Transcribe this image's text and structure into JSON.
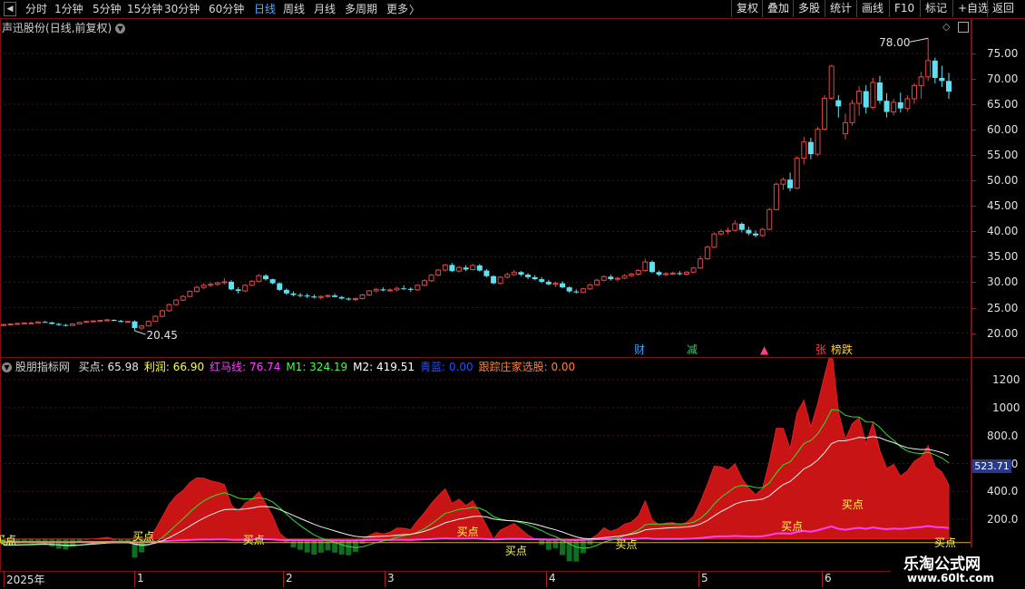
{
  "toolbar": {
    "periods": [
      "分时",
      "1分钟",
      "5分钟",
      "15分钟",
      "30分钟",
      "60分钟",
      "日线",
      "周线",
      "月线",
      "多周期",
      "更多"
    ],
    "active_period": "日线",
    "right_buttons": [
      "复权",
      "叠加",
      "多股",
      "统计",
      "画线",
      "F10",
      "标记",
      "+自选",
      "返回"
    ]
  },
  "main_chart": {
    "stock_name": "声迅股份",
    "mode": "(日线,前复权)",
    "high_label": "78.00",
    "low_label": "20.45",
    "price_axis": [
      "75.00",
      "70.00",
      "65.00",
      "60.00",
      "55.00",
      "50.00",
      "45.00",
      "40.00",
      "35.00",
      "30.00",
      "25.00",
      "20.00"
    ],
    "event_badges": [
      {
        "text": "财",
        "color": "#3ea0ff"
      },
      {
        "text": "减",
        "color": "#33cc66"
      },
      {
        "text": "▲",
        "color": "#ff4080"
      },
      {
        "text": "张",
        "color": "#ff4040"
      },
      {
        "text": "榜跌",
        "color": "#ffd040"
      }
    ]
  },
  "indicator": {
    "name": "股朋指标网",
    "values": [
      {
        "label": "买点:",
        "value": "65.98",
        "color": "#e6e6e6"
      },
      {
        "label": "利润:",
        "value": "66.90",
        "color": "#ffff40"
      },
      {
        "label": "红马线:",
        "value": "76.74",
        "color": "#ff40ff"
      },
      {
        "label": "M1:",
        "value": "324.19",
        "color": "#40ff40"
      },
      {
        "label": "M2:",
        "value": "419.51",
        "color": "#ffffff"
      },
      {
        "label": "青蓝:",
        "value": "0.00",
        "color": "#2050ff"
      },
      {
        "label": "跟踪庄家选股:",
        "value": "0.00",
        "color": "#ff8040"
      }
    ],
    "axis": [
      "1200",
      "1000",
      "800.0",
      "600.0",
      "400.0",
      "200.0"
    ],
    "current_value": "523.71",
    "signal_label": "买点"
  },
  "time_axis": [
    "2025年",
    "1",
    "2",
    "3",
    "4",
    "5",
    "6"
  ],
  "watermark": {
    "line1": "乐淘公式网",
    "line2": "www.60lt.com"
  },
  "chart_data": {
    "type": "candlestick",
    "title": "声迅股份(日线,前复权)",
    "ylim": [
      18.5,
      80
    ],
    "months": [
      "2025年",
      "1",
      "2",
      "3",
      "4",
      "5",
      "6"
    ],
    "high_point": 78.0,
    "low_point": 20.45,
    "ohlc": [
      [
        21.5,
        21.8,
        21.3,
        21.7
      ],
      [
        21.7,
        21.9,
        21.5,
        21.8
      ],
      [
        21.8,
        22.0,
        21.6,
        21.9
      ],
      [
        21.9,
        22.1,
        21.7,
        22.0
      ],
      [
        22.0,
        22.2,
        21.8,
        22.0
      ],
      [
        22.0,
        22.3,
        21.9,
        22.2
      ],
      [
        22.2,
        22.4,
        22.0,
        22.1
      ],
      [
        22.1,
        22.2,
        21.7,
        21.8
      ],
      [
        21.8,
        22.0,
        21.4,
        21.6
      ],
      [
        21.6,
        21.8,
        21.3,
        21.5
      ],
      [
        21.5,
        21.9,
        21.4,
        21.8
      ],
      [
        21.8,
        22.2,
        21.7,
        22.1
      ],
      [
        22.1,
        22.4,
        22.0,
        22.3
      ],
      [
        22.3,
        22.5,
        22.1,
        22.4
      ],
      [
        22.4,
        22.6,
        22.2,
        22.5
      ],
      [
        22.5,
        22.8,
        22.3,
        22.6
      ],
      [
        22.6,
        22.7,
        22.3,
        22.4
      ],
      [
        22.4,
        22.6,
        22.1,
        22.2
      ],
      [
        22.2,
        22.4,
        22.0,
        22.3
      ],
      [
        22.3,
        22.5,
        20.45,
        21.0
      ],
      [
        21.0,
        21.6,
        20.6,
        21.4
      ],
      [
        21.4,
        22.5,
        21.3,
        22.3
      ],
      [
        22.3,
        23.5,
        22.2,
        23.3
      ],
      [
        23.3,
        24.6,
        23.1,
        24.4
      ],
      [
        24.4,
        25.8,
        24.2,
        25.6
      ],
      [
        25.6,
        26.7,
        25.4,
        26.5
      ],
      [
        26.5,
        27.5,
        26.3,
        27.2
      ],
      [
        27.2,
        28.4,
        27.0,
        28.2
      ],
      [
        28.2,
        29.3,
        28.0,
        29.0
      ],
      [
        29.0,
        29.8,
        28.7,
        29.4
      ],
      [
        29.4,
        30.0,
        29.1,
        29.6
      ],
      [
        29.6,
        30.1,
        29.3,
        29.9
      ],
      [
        29.9,
        30.8,
        29.6,
        30.1
      ],
      [
        30.1,
        30.4,
        28.4,
        28.6
      ],
      [
        28.6,
        29.0,
        27.8,
        28.3
      ],
      [
        28.3,
        29.6,
        28.1,
        29.4
      ],
      [
        29.4,
        30.4,
        29.2,
        30.2
      ],
      [
        30.2,
        31.6,
        30.0,
        31.3
      ],
      [
        31.3,
        31.6,
        30.3,
        30.6
      ],
      [
        30.6,
        30.7,
        29.6,
        29.8
      ],
      [
        29.8,
        30.0,
        28.3,
        28.5
      ],
      [
        28.5,
        28.8,
        27.5,
        27.8
      ],
      [
        27.8,
        28.2,
        27.2,
        27.5
      ],
      [
        27.5,
        27.9,
        27.0,
        27.4
      ],
      [
        27.4,
        27.8,
        26.9,
        27.2
      ],
      [
        27.2,
        27.6,
        26.8,
        27.0
      ],
      [
        27.0,
        27.4,
        26.6,
        27.2
      ],
      [
        27.2,
        27.6,
        26.9,
        27.4
      ],
      [
        27.4,
        27.8,
        27.0,
        27.1
      ],
      [
        27.1,
        27.3,
        26.6,
        26.8
      ],
      [
        26.8,
        27.0,
        26.4,
        26.6
      ],
      [
        26.6,
        27.0,
        26.3,
        26.8
      ],
      [
        26.8,
        27.7,
        26.6,
        27.5
      ],
      [
        27.5,
        28.5,
        27.3,
        28.3
      ],
      [
        28.3,
        28.9,
        28.0,
        28.6
      ],
      [
        28.6,
        29.0,
        28.2,
        28.4
      ],
      [
        28.4,
        28.8,
        28.1,
        28.5
      ],
      [
        28.5,
        29.1,
        28.2,
        28.8
      ],
      [
        28.8,
        29.4,
        28.5,
        28.7
      ],
      [
        28.7,
        29.0,
        28.1,
        28.5
      ],
      [
        28.5,
        29.6,
        28.3,
        29.4
      ],
      [
        29.4,
        30.6,
        29.2,
        30.3
      ],
      [
        30.3,
        31.6,
        30.1,
        31.4
      ],
      [
        31.4,
        32.6,
        31.2,
        32.4
      ],
      [
        32.4,
        33.6,
        32.1,
        33.4
      ],
      [
        33.4,
        33.8,
        32.0,
        32.2
      ],
      [
        32.2,
        33.2,
        31.9,
        32.9
      ],
      [
        32.9,
        33.4,
        32.2,
        32.5
      ],
      [
        32.5,
        33.6,
        32.3,
        33.3
      ],
      [
        33.3,
        33.6,
        32.1,
        32.3
      ],
      [
        32.3,
        32.6,
        31.0,
        31.2
      ],
      [
        31.2,
        31.4,
        29.6,
        29.8
      ],
      [
        29.8,
        31.2,
        29.6,
        31.0
      ],
      [
        31.0,
        31.9,
        30.7,
        31.5
      ],
      [
        31.5,
        32.4,
        31.3,
        32.0
      ],
      [
        32.0,
        32.2,
        31.2,
        31.5
      ],
      [
        31.5,
        31.8,
        30.6,
        31.0
      ],
      [
        31.0,
        31.4,
        30.4,
        30.6
      ],
      [
        30.6,
        31.0,
        29.8,
        30.1
      ],
      [
        30.1,
        30.5,
        29.4,
        29.6
      ],
      [
        29.6,
        30.1,
        29.1,
        29.8
      ],
      [
        29.8,
        30.2,
        28.8,
        29.0
      ],
      [
        29.0,
        29.2,
        27.9,
        28.2
      ],
      [
        28.2,
        28.6,
        27.8,
        28.0
      ],
      [
        28.0,
        28.9,
        27.9,
        28.7
      ],
      [
        28.7,
        29.7,
        28.5,
        29.5
      ],
      [
        29.5,
        30.7,
        29.3,
        30.4
      ],
      [
        30.4,
        31.4,
        30.2,
        31.1
      ],
      [
        31.1,
        31.5,
        30.3,
        30.6
      ],
      [
        30.6,
        31.1,
        30.2,
        30.8
      ],
      [
        30.8,
        31.6,
        30.6,
        31.3
      ],
      [
        31.3,
        31.9,
        31.0,
        31.6
      ],
      [
        31.6,
        32.6,
        31.3,
        32.3
      ],
      [
        32.3,
        34.6,
        32.1,
        34.0
      ],
      [
        34.0,
        34.3,
        31.8,
        32.0
      ],
      [
        32.0,
        32.3,
        31.2,
        31.5
      ],
      [
        31.5,
        32.0,
        31.2,
        31.7
      ],
      [
        31.7,
        32.1,
        31.4,
        31.8
      ],
      [
        31.8,
        32.2,
        31.4,
        31.6
      ],
      [
        31.6,
        32.2,
        31.3,
        32.0
      ],
      [
        32.0,
        33.0,
        31.8,
        32.8
      ],
      [
        32.8,
        35.2,
        32.6,
        34.6
      ],
      [
        34.6,
        37.2,
        34.4,
        36.9
      ],
      [
        36.9,
        39.8,
        36.7,
        39.5
      ],
      [
        39.5,
        40.4,
        39.2,
        40.0
      ],
      [
        40.0,
        40.8,
        39.4,
        40.2
      ],
      [
        40.2,
        42.2,
        40.0,
        41.5
      ],
      [
        41.5,
        41.8,
        39.8,
        40.3
      ],
      [
        40.3,
        40.9,
        39.2,
        39.6
      ],
      [
        39.6,
        40.2,
        38.8,
        39.2
      ],
      [
        39.2,
        40.7,
        38.9,
        40.4
      ],
      [
        40.4,
        44.6,
        40.2,
        44.3
      ],
      [
        44.3,
        49.6,
        44.1,
        49.3
      ],
      [
        49.3,
        50.6,
        48.2,
        50.2
      ],
      [
        50.2,
        51.6,
        47.9,
        48.5
      ],
      [
        48.5,
        54.8,
        48.3,
        54.4
      ],
      [
        54.4,
        58.6,
        53.2,
        57.6
      ],
      [
        57.6,
        58.4,
        54.2,
        55.2
      ],
      [
        55.2,
        60.6,
        54.8,
        60.1
      ],
      [
        60.1,
        66.8,
        59.8,
        66.2
      ],
      [
        66.2,
        72.8,
        65.9,
        72.5
      ],
      [
        65.8,
        66.8,
        62.4,
        64.6
      ],
      [
        59.2,
        63.2,
        58.1,
        61.4
      ],
      [
        61.4,
        65.9,
        60.8,
        65.2
      ],
      [
        65.2,
        68.6,
        62.8,
        67.6
      ],
      [
        67.6,
        68.8,
        63.2,
        64.4
      ],
      [
        64.4,
        70.2,
        64.0,
        69.3
      ],
      [
        69.3,
        70.6,
        65.1,
        65.7
      ],
      [
        65.7,
        67.2,
        62.4,
        63.5
      ],
      [
        63.5,
        66.1,
        62.8,
        65.4
      ],
      [
        65.4,
        67.3,
        63.4,
        64.2
      ],
      [
        64.2,
        66.8,
        63.6,
        66.1
      ],
      [
        66.1,
        69.2,
        65.1,
        68.7
      ],
      [
        68.7,
        71.4,
        66.1,
        70.4
      ],
      [
        70.4,
        78.0,
        69.6,
        73.6
      ],
      [
        73.6,
        74.2,
        69.1,
        70.2
      ],
      [
        70.2,
        72.6,
        68.4,
        69.6
      ],
      [
        69.6,
        71.2,
        66.1,
        67.5
      ]
    ]
  }
}
